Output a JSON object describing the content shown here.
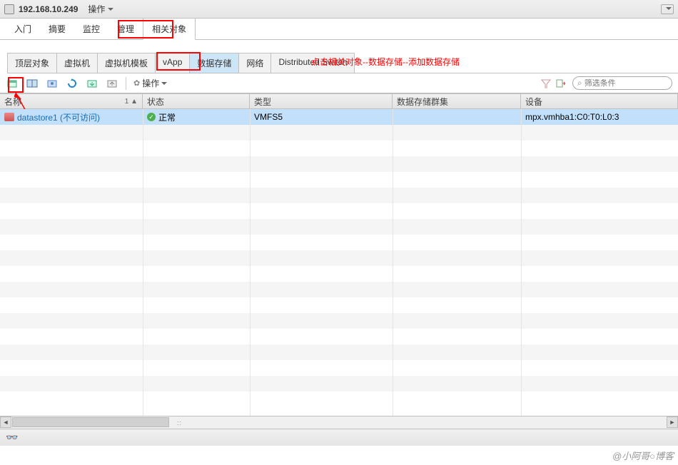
{
  "title_bar": {
    "ip": "192.168.10.249",
    "operations": "操作"
  },
  "main_tabs": [
    "入门",
    "摘要",
    "监控",
    "管理",
    "相关对象"
  ],
  "main_tab_active": 4,
  "sub_tabs": [
    "顶层对象",
    "虚拟机",
    "虚拟机模板",
    "vApp",
    "数据存储",
    "网络",
    "Distributed Switch"
  ],
  "sub_tab_active": 4,
  "annotations": {
    "main_hint": "点击相关对象--数据存储--添加数据存储",
    "arrow_label": "添加数据存储"
  },
  "toolbar": {
    "operations": "操作",
    "search_placeholder": "筛选条件"
  },
  "columns": {
    "name": "名称",
    "status": "状态",
    "type": "类型",
    "cluster": "数据存储群集",
    "device": "设备",
    "sort_indicator": "1 ▲"
  },
  "rows": [
    {
      "name": "datastore1 (不可访问)",
      "status": "正常",
      "type": "VMFS5",
      "cluster": "",
      "device": "mpx.vmhba1:C0:T0:L0:3"
    }
  ],
  "watermark": "@小阿哥○博客"
}
